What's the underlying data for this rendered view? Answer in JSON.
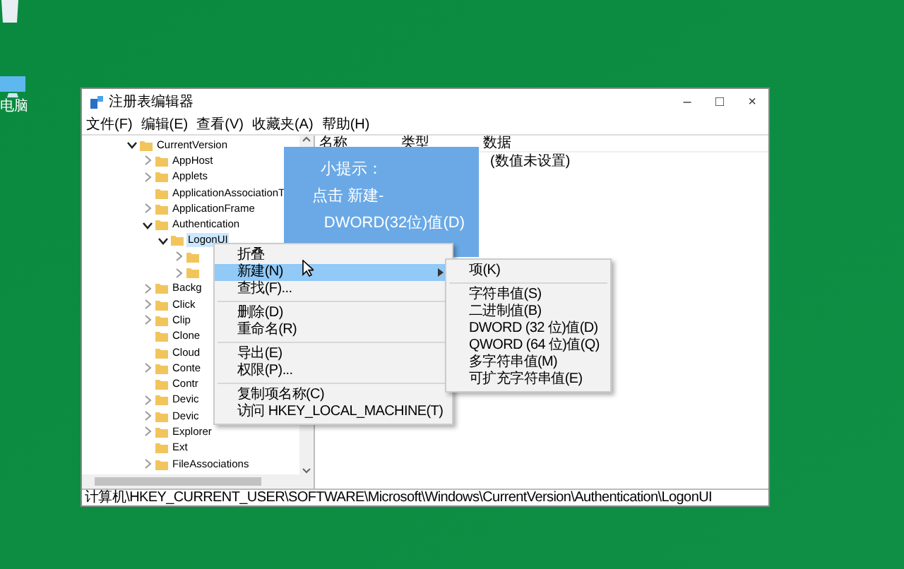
{
  "desktop": {
    "icons": [
      {
        "kind": "recycle"
      },
      {
        "kind": "computer",
        "label": "电脑"
      }
    ]
  },
  "window": {
    "title": "注册表编辑器",
    "controls": [
      "–",
      "□",
      "×"
    ]
  },
  "menu_bar": [
    "文件(F)",
    "编辑(E)",
    "查看(V)",
    "收藏夹(A)",
    "帮助(H)"
  ],
  "tree": [
    {
      "name": "CurrentVersion",
      "expanded": true,
      "selected": false,
      "children": [
        {
          "name": "AppHost",
          "expanded": false,
          "selected": false
        },
        {
          "name": "Applets",
          "expanded": false,
          "selected": false
        },
        {
          "name": "ApplicationAssociationT",
          "selected": false
        },
        {
          "name": "ApplicationFrame",
          "expanded": false,
          "selected": false
        },
        {
          "name": "Authentication",
          "expanded": true,
          "selected": false,
          "children": [
            {
              "name": "LogonUI",
              "expanded": true,
              "selected": true,
              "children": [
                {
                  "expanded": false,
                  "selected": false
                },
                {
                  "expanded": false,
                  "selected": false
                }
              ]
            }
          ]
        },
        {
          "name": "Backg",
          "expanded": false,
          "selected": false
        },
        {
          "name": "Click",
          "expanded": false,
          "selected": false
        },
        {
          "name": "Clip",
          "expanded": false,
          "selected": false
        },
        {
          "name": "Clone",
          "selected": false
        },
        {
          "name": "Cloud",
          "selected": false
        },
        {
          "name": "Conte",
          "expanded": false,
          "selected": false
        },
        {
          "name": "Contr",
          "selected": false
        },
        {
          "name": "Devic",
          "expanded": false,
          "selected": false
        },
        {
          "name": "Devic",
          "expanded": false,
          "selected": false
        },
        {
          "name": "Explorer",
          "expanded": false,
          "selected": false
        },
        {
          "name": "Ext",
          "selected": false
        },
        {
          "name": "FileAssociations",
          "expanded": false,
          "selected": false
        }
      ]
    }
  ],
  "values_table": {
    "columns": [
      "名称",
      "类型",
      "数据"
    ],
    "rows": [
      {
        "data": "(数值未设置)"
      }
    ]
  },
  "status_bar": "计算机\\HKEY_CURRENT_USER\\SOFTWARE\\Microsoft\\Windows\\CurrentVersion\\Authentication\\LogonUI",
  "tip": {
    "lines": [
      "小提示：",
      "点击 新建-",
      "DWORD(32位)值(D)"
    ]
  },
  "context_menu": [
    {
      "kind": "item",
      "label": "折叠",
      "selected": false
    },
    {
      "kind": "item",
      "label": "新建(N)",
      "selected": true,
      "submenu": true
    },
    {
      "kind": "item",
      "label": "查找(F)...",
      "selected": false
    },
    {
      "kind": "separator"
    },
    {
      "kind": "item",
      "label": "删除(D)",
      "selected": false
    },
    {
      "kind": "item",
      "label": "重命名(R)",
      "selected": false
    },
    {
      "kind": "separator"
    },
    {
      "kind": "item",
      "label": "导出(E)",
      "selected": false
    },
    {
      "kind": "item",
      "label": "权限(P)...",
      "selected": false
    },
    {
      "kind": "separator"
    },
    {
      "kind": "item",
      "label": "复制项名称(C)",
      "selected": false
    },
    {
      "kind": "item",
      "label": "访问 HKEY_LOCAL_MACHINE(T)",
      "selected": false
    }
  ],
  "submenu": [
    {
      "kind": "item",
      "label": "项(K)",
      "selected": false
    },
    {
      "kind": "separator"
    },
    {
      "kind": "item",
      "label": "字符串值(S)",
      "selected": false
    },
    {
      "kind": "item",
      "label": "二进制值(B)",
      "selected": false
    },
    {
      "kind": "item",
      "label": "DWORD (32 位)值(D)",
      "selected": false
    },
    {
      "kind": "item",
      "label": "QWORD (64 位)值(Q)",
      "selected": false
    },
    {
      "kind": "item",
      "label": "多字符串值(M)",
      "selected": false
    },
    {
      "kind": "item",
      "label": "可扩充字符串值(E)",
      "selected": false
    }
  ]
}
